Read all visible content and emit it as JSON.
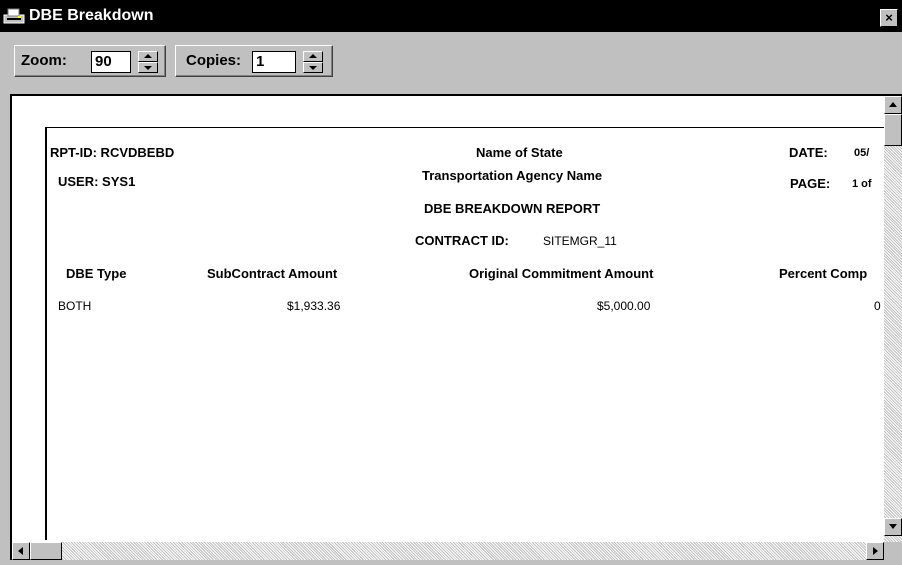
{
  "window": {
    "title": "DBE Breakdown",
    "close_label": "×"
  },
  "toolbar": {
    "zoom_label": "Zoom:",
    "zoom_value": "90",
    "copies_label": "Copies:",
    "copies_value": "1"
  },
  "report": {
    "rpt_id": "RPT-ID: RCVDBEBD",
    "user": "USER:  SYS1",
    "state_name": "Name of State",
    "agency_name": "Transportation Agency Name",
    "report_title": "DBE BREAKDOWN REPORT",
    "contract_label": "CONTRACT ID:",
    "contract_value": "SITEMGR_11",
    "date_label": "DATE:",
    "date_value": "05/",
    "page_label": "PAGE:",
    "page_value": "1 of",
    "columns": [
      "DBE Type",
      "SubContract Amount",
      "Original Commitment Amount",
      "Percent Comp"
    ],
    "rows": [
      {
        "dbe_type": "BOTH",
        "subcontract_amount": "$1,933.36",
        "original_commitment": "$5,000.00",
        "percent": "0"
      }
    ]
  },
  "colors": {
    "titlebar": "#000000",
    "chrome": "#c0c0c0",
    "page": "#ffffff"
  },
  "icons": [
    "printer-icon",
    "close-icon",
    "spin-up-icon",
    "spin-down-icon",
    "scroll-up-icon",
    "scroll-down-icon",
    "scroll-left-icon",
    "scroll-right-icon"
  ]
}
